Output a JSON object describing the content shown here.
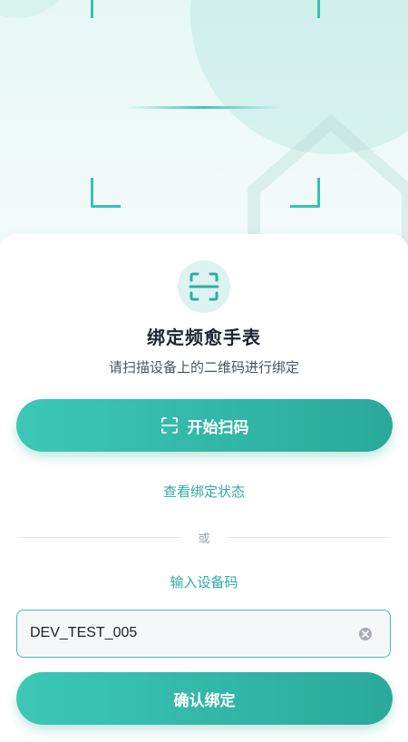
{
  "hero": {
    "decor": "scan-frame-with-animated-line"
  },
  "badge": {
    "icon": "scan-icon"
  },
  "title": "绑定频愈手表",
  "subtitle": "请扫描设备上的二维码进行绑定",
  "scan_button": {
    "label": "开始扫码",
    "icon": "scan-icon"
  },
  "view_status_link": "查看绑定状态",
  "divider_text": "或",
  "input_code_link": "输入设备码",
  "device_input": {
    "value": "DEV_TEST_005",
    "clear_icon": "clear-icon"
  },
  "confirm_button": {
    "label": "确认绑定"
  },
  "colors": {
    "accent": "#2fae9f",
    "button_start": "#3cc7b6",
    "button_end": "#2aa99b",
    "hero_bg": "#e6f7f5"
  }
}
